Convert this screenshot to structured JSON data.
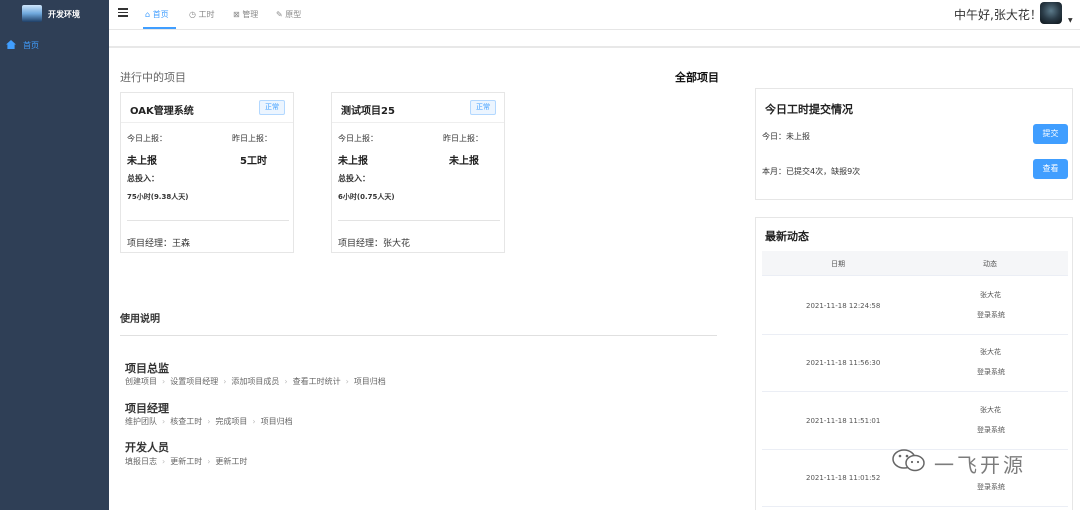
{
  "app": {
    "name": "开发环境"
  },
  "sidebar": {
    "items": [
      {
        "label": "首页",
        "icon": "home-icon"
      }
    ]
  },
  "topnav": {
    "tabs": [
      {
        "label": "首页",
        "icon": "home-icon",
        "active": true
      },
      {
        "label": "工时",
        "icon": "clock-icon",
        "active": false
      },
      {
        "label": "管理",
        "icon": "grid-icon",
        "active": false
      },
      {
        "label": "原型",
        "icon": "edit-icon",
        "active": false
      }
    ],
    "greeting": "中午好,张大花！"
  },
  "projects": {
    "section_title": "进行中的项目",
    "all_link": "全部项目",
    "cards": [
      {
        "name": "OAK管理系统",
        "status": "正常",
        "today_label": "今日上报：",
        "yesterday_label": "昨日上报：",
        "today_value": "未上报",
        "yesterday_value": "5工时",
        "total_label": "总投入：",
        "total_value": "75小时(9.38人天)",
        "manager": "项目经理：王森"
      },
      {
        "name": "测试项目25",
        "status": "正常",
        "today_label": "今日上报：",
        "yesterday_label": "昨日上报：",
        "today_value": "未上报",
        "yesterday_value": "未上报",
        "total_label": "总投入：",
        "total_value": "6小时(0.75人天)",
        "manager": "项目经理：张大花"
      }
    ]
  },
  "usage": {
    "title": "使用说明",
    "roles": [
      {
        "name": "项目总监",
        "steps": [
          "创建项目",
          "设置项目经理",
          "添加项目成员",
          "查看工时统计",
          "项目归档"
        ]
      },
      {
        "name": "项目经理",
        "steps": [
          "维护团队",
          "核查工时",
          "完成项目",
          "项目归档"
        ]
      },
      {
        "name": "开发人员",
        "steps": [
          "填报日志",
          "更新工时",
          "更新工时"
        ]
      }
    ]
  },
  "timesheet": {
    "title": "今日工时提交情况",
    "today_text": "今日：未上报",
    "submit_label": "提交",
    "month_text": "本月：已提交4次，缺报9次",
    "view_label": "查看"
  },
  "activity": {
    "title": "最新动态",
    "col_date": "日期",
    "col_action": "动态",
    "rows": [
      {
        "date": "2021-11-18 12:24:58",
        "user": "张大花",
        "action": "登录系统"
      },
      {
        "date": "2021-11-18 11:56:30",
        "user": "张大花",
        "action": "登录系统"
      },
      {
        "date": "2021-11-18 11:51:01",
        "user": "张大花",
        "action": "登录系统"
      },
      {
        "date": "2021-11-18 11:01:52",
        "user": "",
        "action": "登录系统"
      }
    ]
  },
  "watermark": {
    "text": "一飞开源"
  }
}
